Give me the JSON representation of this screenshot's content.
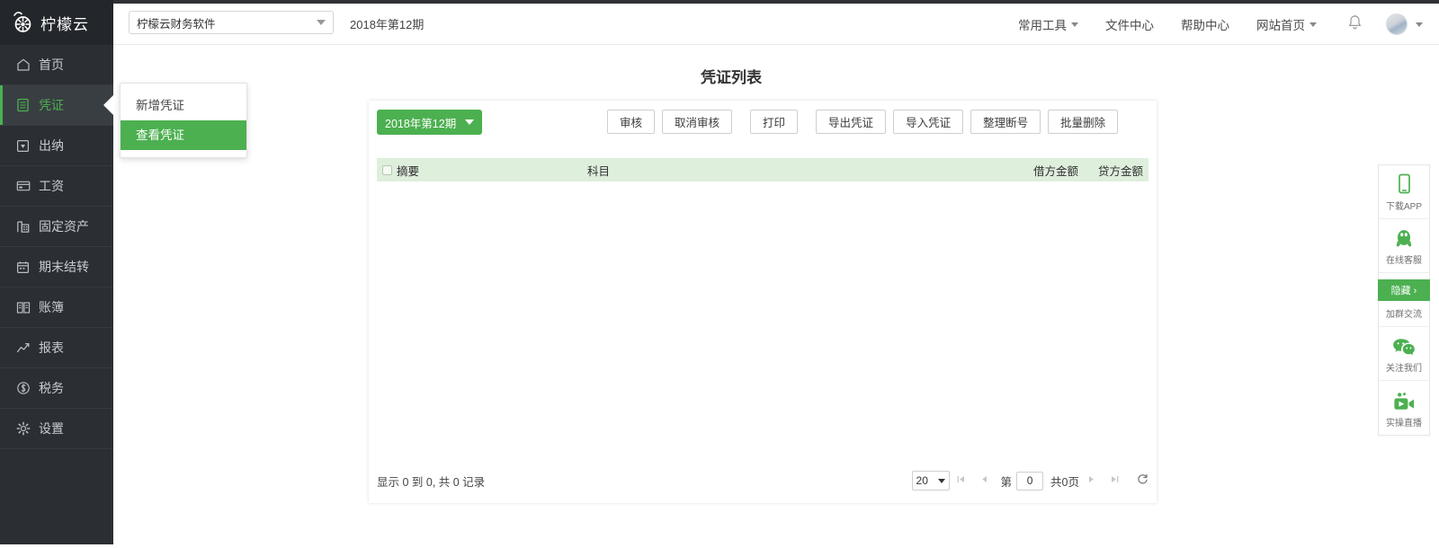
{
  "brand": {
    "name": "柠檬云",
    "logo_icon": "lemon-slice-icon",
    "accent": "#4cb050",
    "sidebar_bg": "#2b2f33"
  },
  "header": {
    "company_select": {
      "value": "柠檬云财务软件",
      "caret_icon": "chevron-down-icon"
    },
    "period": "2018年第12期",
    "menus": [
      {
        "label": "常用工具",
        "has_caret": true
      },
      {
        "label": "文件中心",
        "has_caret": false
      },
      {
        "label": "帮助中心",
        "has_caret": false
      },
      {
        "label": "网站首页",
        "has_caret": true
      }
    ],
    "bell_icon": "bell-icon",
    "avatar_icon": "avatar",
    "avatar_caret_icon": "chevron-down-icon"
  },
  "sidebar": {
    "items": [
      {
        "label": "首页",
        "icon": "home-icon",
        "active": false
      },
      {
        "label": "凭证",
        "icon": "document-icon",
        "active": true
      },
      {
        "label": "出纳",
        "icon": "cashier-icon",
        "active": false
      },
      {
        "label": "工资",
        "icon": "card-icon",
        "active": false
      },
      {
        "label": "固定资产",
        "icon": "building-icon",
        "active": false
      },
      {
        "label": "期末结转",
        "icon": "calendar-icon",
        "active": false
      },
      {
        "label": "账簿",
        "icon": "book-icon",
        "active": false
      },
      {
        "label": "报表",
        "icon": "chart-icon",
        "active": false
      },
      {
        "label": "税务",
        "icon": "coin-icon",
        "active": false
      },
      {
        "label": "设置",
        "icon": "gear-icon",
        "active": false
      }
    ]
  },
  "submenu": {
    "items": [
      {
        "label": "新增凭证",
        "selected": false
      },
      {
        "label": "查看凭证",
        "selected": true
      }
    ]
  },
  "main": {
    "page_title": "凭证列表",
    "period_button": {
      "label": "2018年第12期",
      "caret_icon": "chevron-down-icon"
    },
    "toolbar_buttons": [
      {
        "label": "审核"
      },
      {
        "label": "取消审核"
      },
      {
        "label": "打印"
      },
      {
        "label": "导出凭证"
      },
      {
        "label": "导入凭证"
      },
      {
        "label": "整理断号"
      },
      {
        "label": "批量删除"
      }
    ],
    "table": {
      "select_all_checkbox": "unchecked",
      "columns": [
        "摘要",
        "科目",
        "借方金额",
        "贷方金额"
      ],
      "rows": []
    },
    "footer": {
      "record_info": "显示 0 到 0, 共 0 记录",
      "page_size": "20",
      "first_icon": "first-page-icon",
      "prev_icon": "prev-page-icon",
      "page_prefix": "第",
      "page_value": "0",
      "page_total": "共0页",
      "next_icon": "next-page-icon",
      "last_icon": "last-page-icon",
      "refresh_icon": "refresh-icon"
    }
  },
  "rightbar": {
    "items": [
      {
        "label": "下载APP",
        "icon": "phone-icon"
      },
      {
        "label": "在线客服",
        "icon": "qq-penguin-icon"
      },
      {
        "label": "加群交流",
        "icon": "group-icon"
      },
      {
        "label": "关注我们",
        "icon": "wechat-icon"
      },
      {
        "label": "实操直播",
        "icon": "video-camera-icon"
      }
    ],
    "hide_label": "隐藏 ›"
  }
}
